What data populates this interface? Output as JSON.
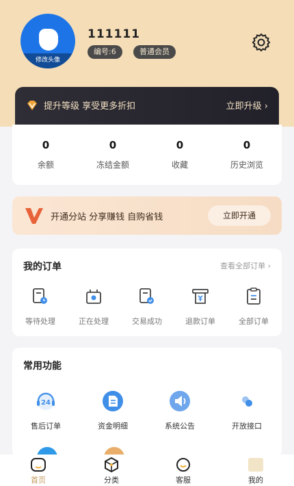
{
  "profile": {
    "username": "111111",
    "avatar_caption": "修改头像",
    "id_badge": "编号:6",
    "level_badge": "普通会员",
    "avatar_color": "#1d74e7"
  },
  "settings_icon": "gear-icon",
  "vip": {
    "text": "提升等级 享受更多折扣",
    "action": "立即升级 ›",
    "icon": "diamond-icon"
  },
  "stats": [
    {
      "value": "0",
      "label": "余额"
    },
    {
      "value": "0",
      "label": "冻结金额"
    },
    {
      "value": "0",
      "label": "收藏"
    },
    {
      "value": "0",
      "label": "历史浏览"
    }
  ],
  "promo": {
    "text": "开通分站 分享赚钱 自购省钱",
    "button": "立即开通",
    "icon": "v-logo-icon"
  },
  "orders": {
    "title": "我的订单",
    "view_all": "查看全部订单 ›",
    "items": [
      {
        "label": "等待处理",
        "icon": "pending-icon"
      },
      {
        "label": "正在处理",
        "icon": "processing-icon"
      },
      {
        "label": "交易成功",
        "icon": "success-icon"
      },
      {
        "label": "退款订单",
        "icon": "refund-icon"
      },
      {
        "label": "全部订单",
        "icon": "all-orders-icon"
      }
    ]
  },
  "functions": {
    "title": "常用功能",
    "items": [
      {
        "label": "售后订单",
        "icon": "after-sales-24-icon"
      },
      {
        "label": "资金明细",
        "icon": "document-icon"
      },
      {
        "label": "系统公告",
        "icon": "speaker-icon"
      },
      {
        "label": "开放接口",
        "icon": "api-icon"
      }
    ]
  },
  "tabbar": [
    {
      "label": "首页",
      "icon": "home-icon",
      "active": true
    },
    {
      "label": "分类",
      "icon": "category-icon",
      "active": false
    },
    {
      "label": "客服",
      "icon": "service-icon",
      "active": false
    },
    {
      "label": "我的",
      "icon": "profile-icon",
      "active": false
    }
  ],
  "colors": {
    "header": "#f4ddb7",
    "accent": "#c49a5d",
    "vip_bar": "#2f2d35",
    "blue_icon": "#3f8ee8"
  }
}
